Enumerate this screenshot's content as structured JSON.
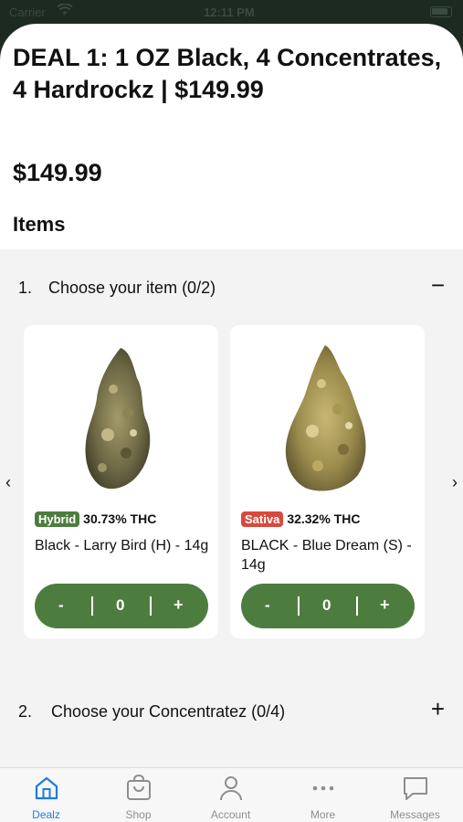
{
  "status_bar": {
    "carrier": "Carrier",
    "time": "12:11 PM"
  },
  "deal": {
    "title": "DEAL 1: 1 OZ Black, 4 Concentrates, 4 Hardrockz | $149.99",
    "price": "$149.99"
  },
  "items_heading": "Items",
  "sections": [
    {
      "number": "1.",
      "label": "Choose your item (0/2)",
      "toggle": "−",
      "expanded": true,
      "products": [
        {
          "strain_type": "Hybrid",
          "strain_color": "#4d7d3e",
          "thc": "30.73% THC",
          "name": "Black - Larry Bird (H) - 14g",
          "minus": "-",
          "quantity": "0",
          "plus": "+"
        },
        {
          "strain_type": "Sativa",
          "strain_color": "#d64a3d",
          "thc": "32.32% THC",
          "name": "BLACK - Blue Dream (S) - 14g",
          "minus": "-",
          "quantity": "0",
          "plus": "+"
        }
      ]
    },
    {
      "number": "2.",
      "label": "Choose your Concentratez (0/4)",
      "toggle": "+",
      "expanded": false
    }
  ],
  "carousel": {
    "prev_icon": "chevron-left-icon",
    "prev_glyph": "‹",
    "next_icon": "chevron-right-icon",
    "next_glyph": "›"
  },
  "tab_bar": {
    "active": "Dealz",
    "tabs": [
      {
        "label": "Dealz",
        "icon": "home-icon"
      },
      {
        "label": "Shop",
        "icon": "shopping-bag-icon"
      },
      {
        "label": "Account",
        "icon": "person-icon"
      },
      {
        "label": "More",
        "icon": "more-dots-icon"
      },
      {
        "label": "Messages",
        "icon": "chat-bubble-icon"
      }
    ]
  },
  "colors": {
    "accent_green": "#4d7d3e",
    "tab_active": "#1f7ae0",
    "tab_inactive": "#8e8e8e"
  }
}
